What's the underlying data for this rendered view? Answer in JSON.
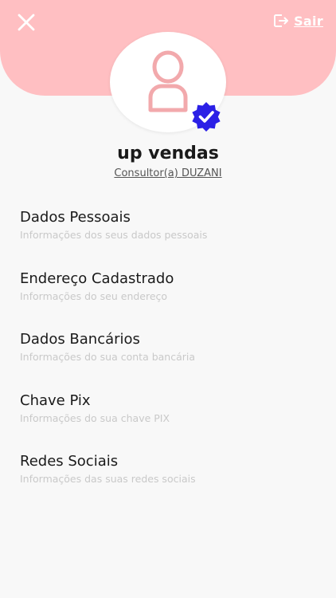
{
  "colors": {
    "header_bg": "#ffbfc2",
    "accent_pink": "#f2a9ac",
    "verified_blue": "#2b20e6"
  },
  "header": {
    "close_icon": "close-icon",
    "logout_icon": "logout-icon",
    "logout_label": "Sair"
  },
  "profile": {
    "avatar_icon": "user-icon",
    "verified_icon": "verified-badge-icon",
    "name": "up vendas",
    "role": "Consultor(a) DUZANI"
  },
  "menu": {
    "items": [
      {
        "title": "Dados Pessoais",
        "subtitle": "Informações dos seus dados pessoais"
      },
      {
        "title": "Endereço Cadastrado",
        "subtitle": "Informações do seu endereço"
      },
      {
        "title": "Dados Bancários",
        "subtitle": "Informações do sua conta bancária"
      },
      {
        "title": "Chave Pix",
        "subtitle": "Informações do sua chave PIX"
      },
      {
        "title": "Redes Sociais",
        "subtitle": "Informações das suas redes sociais"
      }
    ]
  }
}
